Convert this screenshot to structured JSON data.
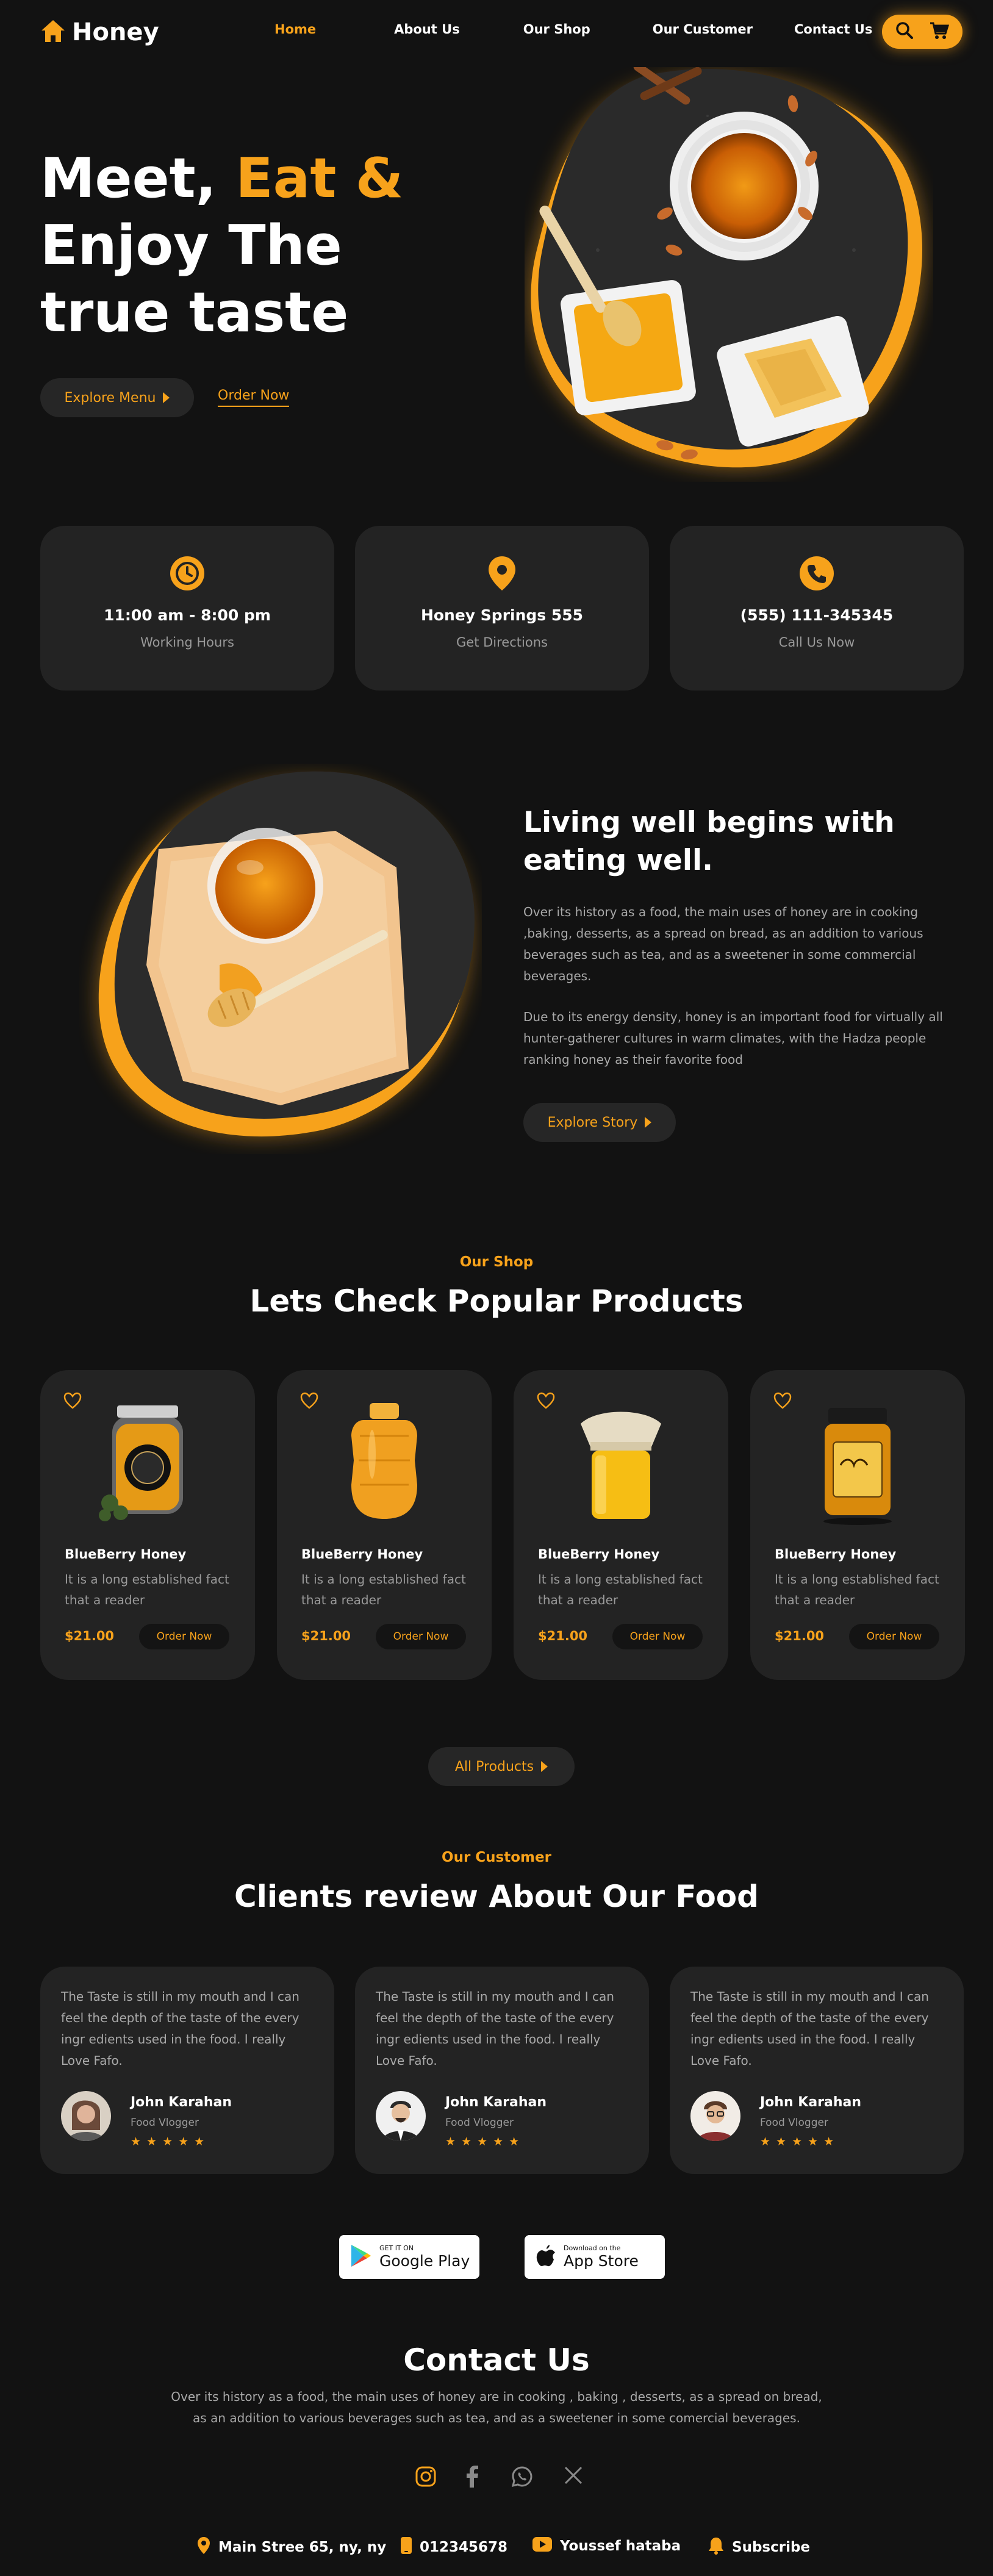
{
  "colors": {
    "accent": "#F7A21B",
    "background": "#121212",
    "card": "#232323"
  },
  "brand": {
    "name": "Honey",
    "icon": "home-icon"
  },
  "nav": {
    "items": [
      "Home",
      "About Us",
      "Our Shop",
      "Our Customer",
      "Contact Us"
    ],
    "active": "Home",
    "icons": [
      "search-icon",
      "cart-icon"
    ]
  },
  "hero": {
    "title_1": "Meet, ",
    "title_accent": "Eat &",
    "title_2": "Enjoy The true taste",
    "explore_label": "Explore Menu",
    "order_label": "Order Now"
  },
  "info": [
    {
      "icon": "clock-icon",
      "title": "11:00 am - 8:00 pm",
      "subtitle": "Working Hours"
    },
    {
      "icon": "location-pin-icon",
      "title": "Honey Springs 555",
      "subtitle": "Get Directions"
    },
    {
      "icon": "phone-icon",
      "title": "(555) 111-345345",
      "subtitle": "Call Us Now"
    }
  ],
  "about": {
    "title": "Living well begins with eating well.",
    "para1": "Over its history as a food, the main uses of honey are in cooking ,baking, desserts, as a spread on bread, as an addition to various beverages such as tea, and as a sweetener in some commercial beverages.",
    "para2": "Due to its energy density, honey is an important food for virtually all hunter-gatherer cultures in warm climates, with the Hadza people ranking honey as their favorite food",
    "button": "Explore Story"
  },
  "shop": {
    "tag": "Our Shop",
    "title": "Lets Check Popular Products",
    "products": [
      {
        "name": "BlueBerry Honey",
        "desc": "It is a long established fact that a reader",
        "price": "$21.00",
        "order": "Order Now"
      },
      {
        "name": "BlueBerry Honey",
        "desc": "It is a long established fact that a reader",
        "price": "$21.00",
        "order": "Order Now"
      },
      {
        "name": "BlueBerry Honey",
        "desc": "It is a long established fact that a reader",
        "price": "$21.00",
        "order": "Order Now"
      },
      {
        "name": "BlueBerry Honey",
        "desc": "It is a long established fact that a reader",
        "price": "$21.00",
        "order": "Order Now"
      }
    ],
    "all_products": "All Products"
  },
  "customers": {
    "tag": "Our Customer",
    "title": "Clients review About Our Food",
    "reviews": [
      {
        "text": "The Taste is still in my mouth and I can feel the depth of the taste of the every ingr edients used in the food. I really Love Fafo.",
        "name": "John Karahan",
        "role": "Food Vlogger",
        "rating": 5
      },
      {
        "text": "The Taste is still in my mouth and I can feel the depth of the taste of the every ingr edients used in the food. I really Love Fafo.",
        "name": "John Karahan",
        "role": "Food Vlogger",
        "rating": 5
      },
      {
        "text": "The Taste is still in my mouth and I can feel the depth of the taste of the every ingr edients used in the food. I really Love Fafo.",
        "name": "John Karahan",
        "role": "Food Vlogger",
        "rating": 5
      }
    ],
    "stars": "★★★★★"
  },
  "stores": {
    "google_small": "GET IT ON",
    "google_big": "Google Play",
    "apple_small": "Download on the",
    "apple_big": "App Store"
  },
  "contact": {
    "title": "Contact Us",
    "text": "Over its history as a food, the main uses of honey are in cooking , baking , desserts, as a spread on bread, as an addition to various beverages such as tea, and as a sweetener in some comercial beverages.",
    "social": [
      "instagram-icon",
      "facebook-icon",
      "whatsapp-icon",
      "x-icon"
    ],
    "footer": [
      {
        "icon": "location-pin-icon",
        "label": "Main Stree 65, ny, ny"
      },
      {
        "icon": "mobile-phone-icon",
        "label": "012345678"
      },
      {
        "icon": "youtube-icon",
        "label": "Youssef hataba"
      },
      {
        "icon": "bell-icon",
        "label": "Subscribe"
      }
    ]
  }
}
